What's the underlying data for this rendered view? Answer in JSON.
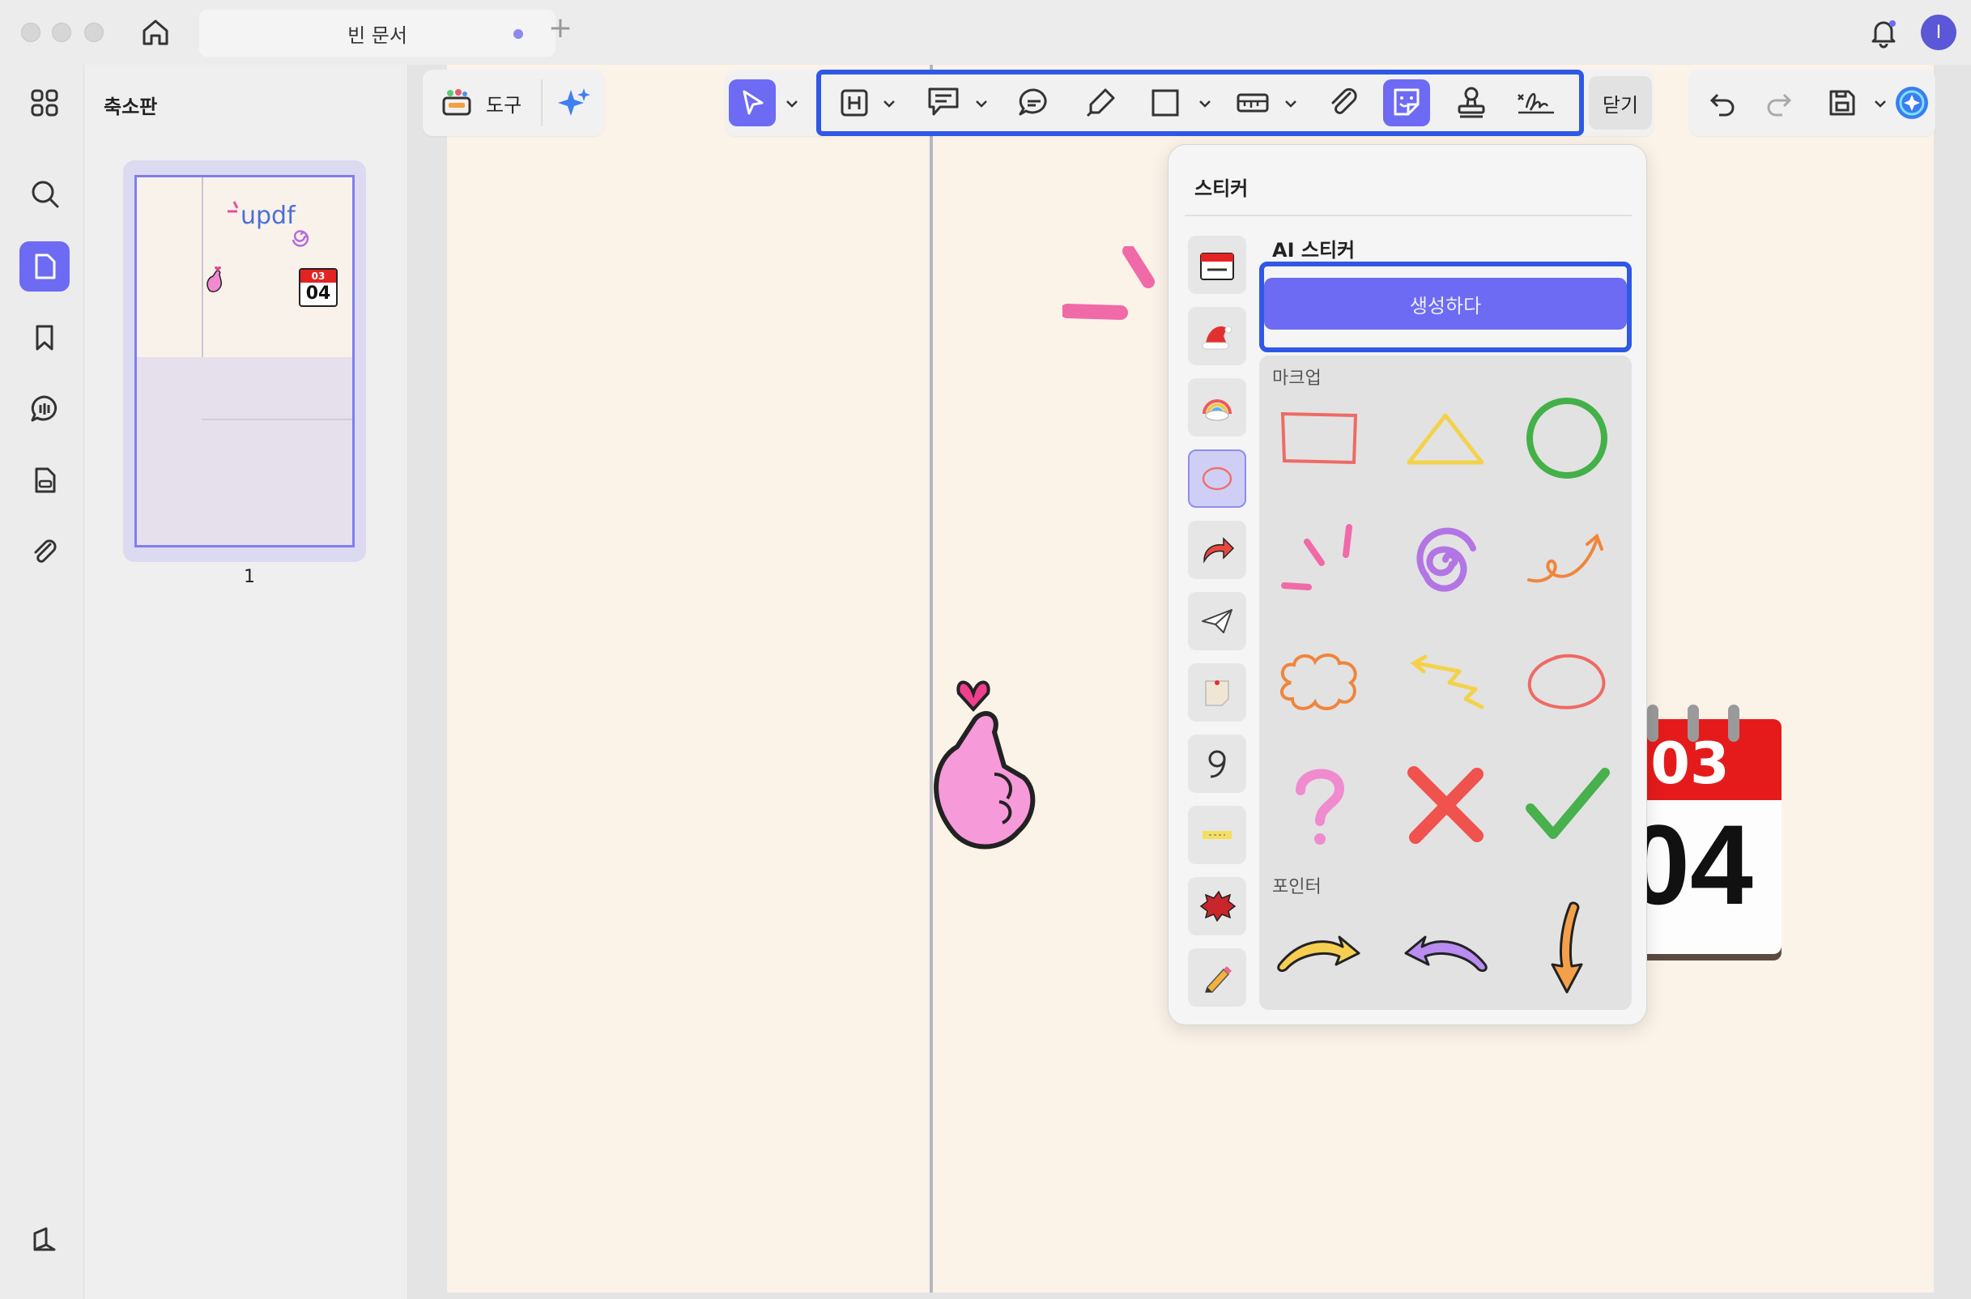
{
  "window": {
    "tab_title": "빈 문서",
    "avatar_initial": "I"
  },
  "thumbnail_panel": {
    "title": "축소판",
    "page_number": "1",
    "thumb_brand_text": "updf",
    "thumb_calendar_month": "03",
    "thumb_calendar_day": "04"
  },
  "toolbar": {
    "tools_label": "도구",
    "close_label": "닫기"
  },
  "sticker_popup": {
    "title": "스티커",
    "ai_title": "AI 스티커",
    "generate_label": "생성하다",
    "markup_label": "마크업",
    "pointer_label": "포인터"
  },
  "canvas": {
    "calendar_month": "03",
    "calendar_day": "04"
  },
  "colors": {
    "accent": "#6d6bf3",
    "highlight_frame": "#2f58e6",
    "page_bg": "#fbf2e8"
  }
}
